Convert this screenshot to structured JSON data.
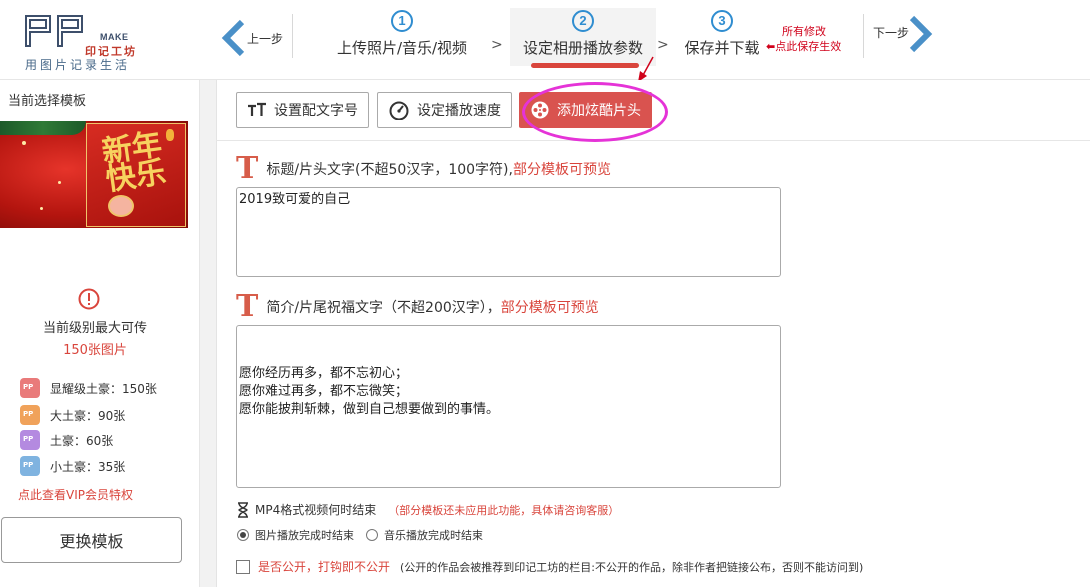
{
  "header": {
    "logo": {
      "make": "MAKE",
      "brand": "印记工坊",
      "slogan": "用图片记录生活"
    },
    "prev_label": "上一步",
    "next_label": "下一步",
    "steps": [
      {
        "num": "1",
        "label": "上传照片/音乐/视频"
      },
      {
        "num": "2",
        "label": "设定相册播放参数"
      },
      {
        "num": "3",
        "label": "保存并下载"
      }
    ],
    "separator": ">",
    "save_note_line1": "所有修改",
    "save_note_line2": "点此保存生效",
    "accent_color": "#d9453c",
    "step_color": "#2f8dd0"
  },
  "sidebar": {
    "title": "当前选择模板",
    "level_text": "当前级别最大可传",
    "level_count": "150张图片",
    "tiers": [
      {
        "label": "显耀级土豪：150张",
        "color": "#e97a7a"
      },
      {
        "label": "大土豪：90张",
        "color": "#f0a25a"
      },
      {
        "label": "土豪：60张",
        "color": "#b48ae0"
      },
      {
        "label": "小土豪：35张",
        "color": "#7fb3e0"
      }
    ],
    "vip_link": "点此查看VIP会员特权",
    "change_button": "更换模板"
  },
  "toolbar": {
    "font_size_button": "设置配文字号",
    "speed_button": "设定播放速度",
    "intro_button": "添加炫酷片头"
  },
  "title_section": {
    "label": "标题/片头文字(不超50汉字，100字符),",
    "hint": "部分模板可预览",
    "value": "2019致可爱的自己"
  },
  "intro_section": {
    "label": "简介/片尾祝福文字（不超200汉字），",
    "hint": "部分模板可预览",
    "value": "\n\n愿你经历再多，都不忘初心；\n愿你难过再多，都不忘微笑；\n愿你能披荆斩棘，做到自己想要做到的事情。"
  },
  "mp4": {
    "label": "MP4格式视频何时结束",
    "note": "（部分模板还未应用此功能，具体请咨询客服）",
    "options": [
      "图片播放完成时结束",
      "音乐播放完成时结束"
    ],
    "selected": "图片播放完成时结束"
  },
  "publish": {
    "label": "是否公开，打钩即不公开",
    "note": "(公开的作品会被推荐到印记工坊的栏目:不公开的作品，除非作者把链接公布，否则不能访问到)"
  }
}
